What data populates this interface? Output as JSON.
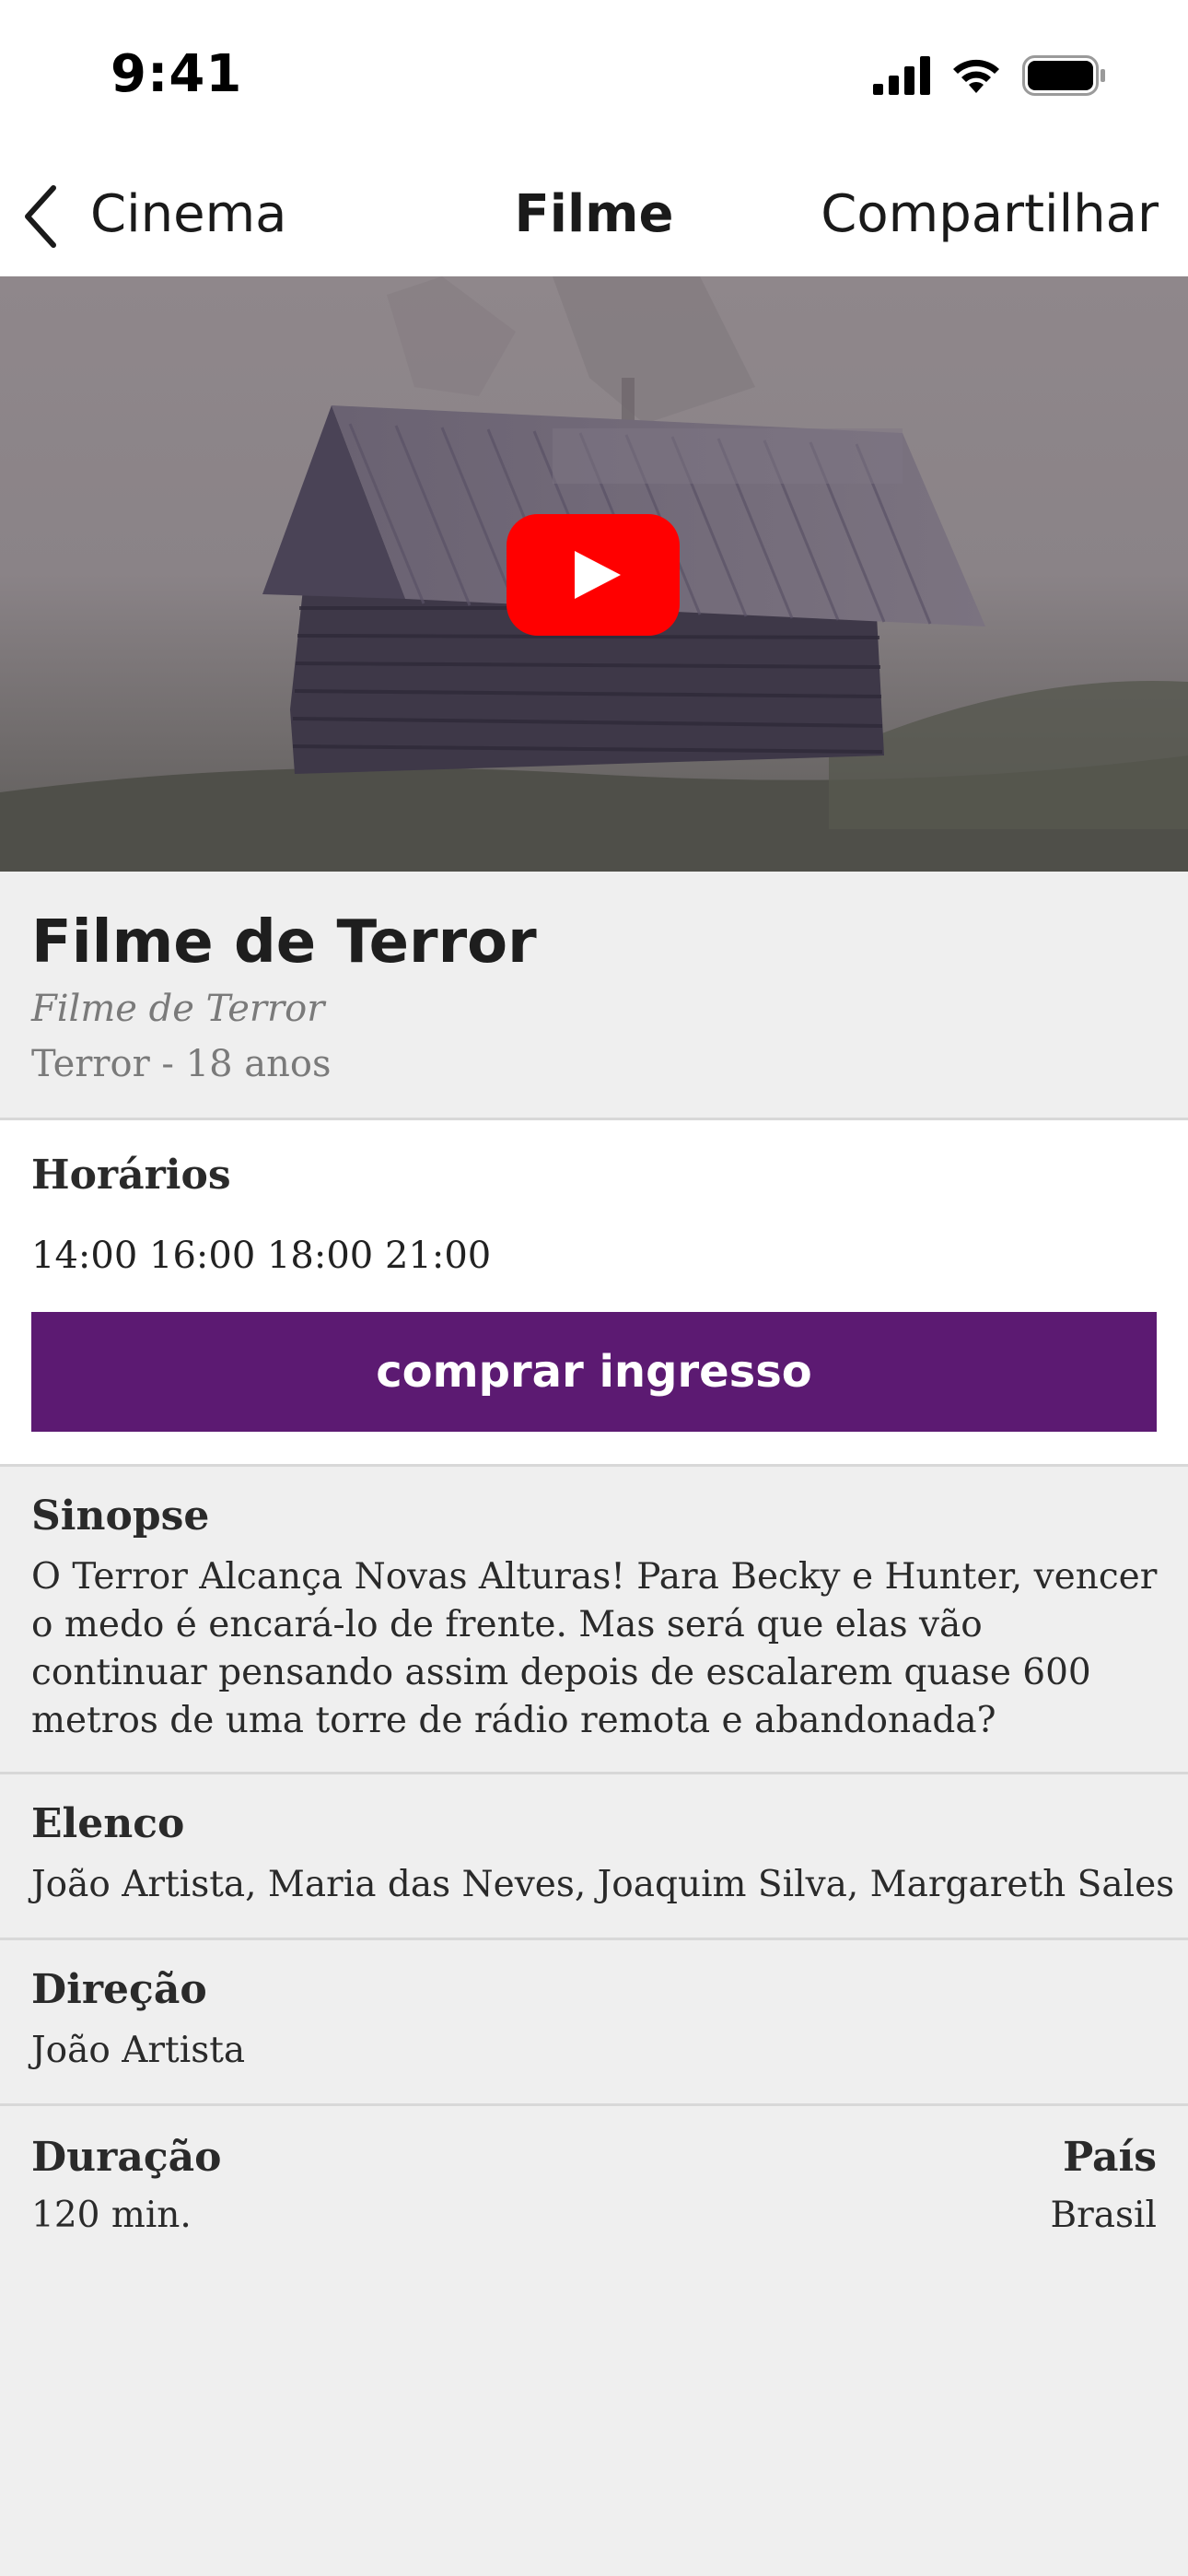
{
  "status_bar": {
    "time": "9:41",
    "icons": [
      "cellular-signal-icon",
      "wifi-icon",
      "battery-icon"
    ]
  },
  "nav": {
    "back_label": "Cinema",
    "title": "Filme",
    "share_label": "Compartilhar"
  },
  "video": {
    "thumbnail": "foggy-wooden-cabin",
    "play_icon": "youtube-play-icon",
    "accent": "#ff0000"
  },
  "movie": {
    "title": "Filme de Terror",
    "original_title": "Filme de Terror",
    "genre_rating": "Terror - 18 anos"
  },
  "showtimes": {
    "label": "Horários",
    "times": "14:00 16:00 18:00 21:00",
    "buy_label": "comprar ingresso",
    "buy_color": "#5c1a72"
  },
  "synopsis": {
    "label": "Sinopse",
    "text": "O Terror Alcança Novas Alturas! Para Becky e Hunter, vencer o medo é encará-lo de frente. Mas será que elas vão continuar pensando assim depois de escalarem quase 600 metros de uma torre de rádio remota e abandonada?"
  },
  "cast": {
    "label": "Elenco",
    "text": "João Artista, Maria das Neves, Joaquim Silva, Margareth Sales"
  },
  "director": {
    "label": "Direção",
    "text": "João Artista"
  },
  "duration": {
    "label": "Duração",
    "value": "120 min."
  },
  "country": {
    "label": "País",
    "value": "Brasil"
  }
}
